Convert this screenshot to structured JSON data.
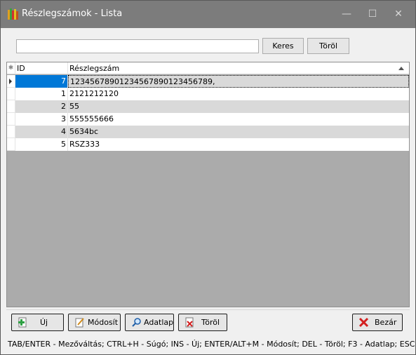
{
  "window": {
    "title": "Részlegszámok - Lista",
    "controls": {
      "minimize": "—",
      "maximize": "☐",
      "close": "✕"
    },
    "titlebar_color": "#7c7c7c"
  },
  "search": {
    "value": "",
    "placeholder": "",
    "search_button": "Keres",
    "clear_button": "Töröl"
  },
  "grid": {
    "columns": [
      "ID",
      "Részlegszám"
    ],
    "header_indicator": "✱",
    "selected_row": 0,
    "rows": [
      {
        "id": "7",
        "value": "1234567890123456789012345​6789,"
      },
      {
        "id": "1",
        "value": "2121212120"
      },
      {
        "id": "2",
        "value": "55"
      },
      {
        "id": "3",
        "value": "555555666"
      },
      {
        "id": "4",
        "value": "5634bc"
      },
      {
        "id": "5",
        "value": "RSZ333"
      }
    ],
    "selection_color": "#0078d7"
  },
  "actions": {
    "new": "Új",
    "edit": "Módosít",
    "datasheet": "Adatlap",
    "delete": "Töröl",
    "close": "Bezár"
  },
  "status": {
    "text": "TAB/ENTER - Mezőváltás; CTRL+H - Súgó; INS - Új; ENTER/ALT+M - Módosít; DEL - Töröl; F3 - Adatlap; ESC"
  },
  "icons": {
    "app": "books-icon",
    "new": "green-plus-document-icon",
    "edit": "pencil-document-icon",
    "datasheet": "magnifier-icon",
    "delete": "red-x-document-icon",
    "close": "red-x-icon"
  }
}
